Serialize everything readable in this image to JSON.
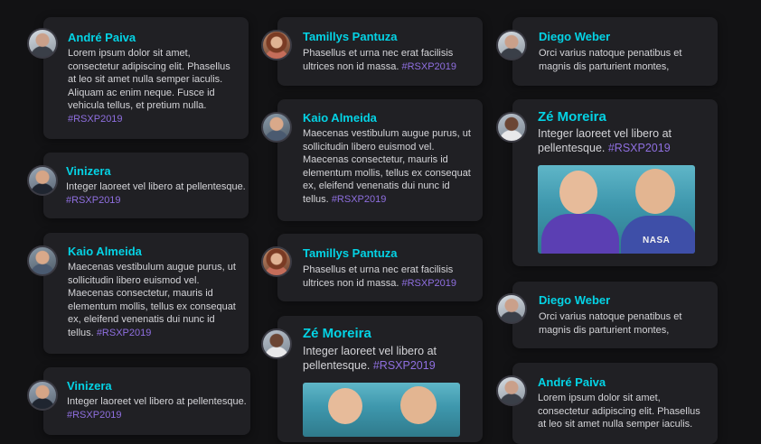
{
  "hashtag": "#RSXP2019",
  "posts": {
    "c1p1": {
      "name": "André Paiva",
      "text": "Lorem ipsum dolor sit amet, consectetur adipiscing elit. Phasellus at leo sit amet nulla semper iaculis. Aliquam ac enim neque. Fusce id vehicula tellus, et pretium nulla.",
      "avatar": "man-avatar-icon"
    },
    "c1p2": {
      "name": "Vinizera",
      "text": "Integer laoreet vel libero at pellentesque.",
      "avatar": "man-avatar-icon"
    },
    "c1p3": {
      "name": "Kaio Almeida",
      "text": "Maecenas vestibulum augue purus, ut sollicitudin libero euismod vel. Maecenas consectetur, mauris id elementum mollis, tellus ex consequat ex, eleifend venenatis dui nunc id tellus.",
      "avatar": "man-avatar-icon"
    },
    "c1p4": {
      "name": "Vinizera",
      "text": "Integer laoreet vel libero at pellentesque.",
      "avatar": "man-avatar-icon"
    },
    "c2p1": {
      "name": "Tamillys Pantuza",
      "text": "Phasellus et urna nec erat facilisis ultrices non id massa.",
      "avatar": "woman-avatar-icon"
    },
    "c2p2": {
      "name": "Kaio Almeida",
      "text": "Maecenas vestibulum augue purus, ut sollicitudin libero euismod vel. Maecenas consectetur, mauris id elementum mollis, tellus ex consequat ex, eleifend venenatis dui nunc id tellus.",
      "avatar": "man-avatar-icon"
    },
    "c2p3": {
      "name": "Tamillys Pantuza",
      "text": "Phasellus et urna nec erat facilisis ultrices non id massa.",
      "avatar": "woman-avatar-icon"
    },
    "c2p4": {
      "name": "Zé Moreira",
      "text": "Integer laoreet vel libero at pellentesque.",
      "avatar": "man-avatar-icon"
    },
    "c3p1": {
      "name": "Diego Weber",
      "text": "Orci varius natoque penatibus et magnis dis parturient montes,",
      "avatar": "man-avatar-icon"
    },
    "c3p2": {
      "name": "Zé Moreira",
      "text": "Integer laoreet vel libero at pellentesque.",
      "avatar": "man-avatar-icon",
      "photo_shirt_text": "NASA"
    },
    "c3p3": {
      "name": "Diego Weber",
      "text": "Orci varius natoque penatibus et magnis dis parturient montes,",
      "avatar": "man-avatar-icon"
    },
    "c3p4": {
      "name": "André Paiva",
      "text": "Lorem ipsum dolor sit amet, consectetur adipiscing elit. Phasellus at leo sit amet nulla semper iaculis.",
      "avatar": "man-avatar-icon"
    }
  }
}
